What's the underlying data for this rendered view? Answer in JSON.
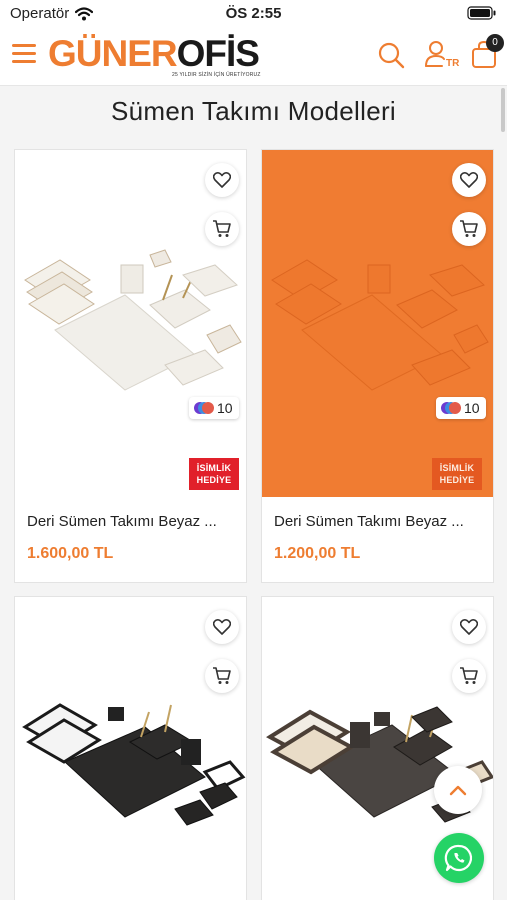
{
  "status_bar": {
    "carrier": "Operatör",
    "time": "ÖS 2:55"
  },
  "header": {
    "brand_left": "GÜNER",
    "brand_right": "OFİS",
    "brand_tagline": "25 YILDIR SİZİN İÇİN ÜRETİYORUZ",
    "language": "TR",
    "cart_count": "0"
  },
  "page": {
    "title": "Sümen Takımı Modelleri"
  },
  "products": [
    {
      "name": "Deri Sümen Takımı Beyaz ...",
      "price": "1.600,00 TL",
      "colors": "10",
      "badge": "İSİMLİK HEDİYE",
      "image_tone": "white"
    },
    {
      "name": "Deri Sümen Takımı Beyaz ...",
      "price": "1.200,00 TL",
      "colors": "10",
      "badge": "İSİMLİK HEDİYE",
      "image_tone": "orange"
    },
    {
      "name": "",
      "price": "",
      "image_tone": "black"
    },
    {
      "name": "",
      "price": "",
      "image_tone": "brown"
    }
  ],
  "colors": {
    "accent": "#ee7d31",
    "badge_red": "#e1202a",
    "whatsapp": "#25d366"
  }
}
